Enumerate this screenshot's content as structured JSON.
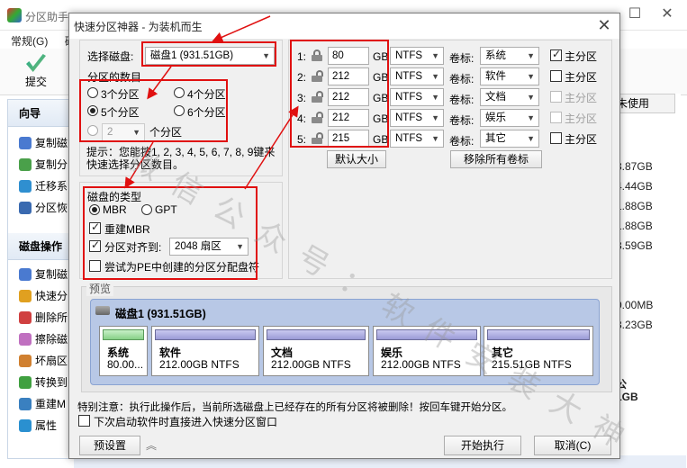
{
  "app": {
    "title": "分区助手",
    "menu": [
      "常规(G)",
      "磁"
    ],
    "toolbar": {
      "commit_label": "提交"
    },
    "sidebar": {
      "wizard_header": "向导",
      "wizard_items": [
        "复制磁",
        "复制分",
        "迁移系",
        "分区恢"
      ],
      "disk_ops_header": "磁盘操作",
      "disk_ops_items": [
        "复制磁",
        "快速分",
        "删除所",
        "擦除磁",
        "坏扇区",
        "转换到",
        "重建M",
        "属性"
      ]
    },
    "right_panel": {
      "header": "未使用",
      "values": [
        "3.87GB",
        "4.44GB",
        "1.88GB",
        "1.88GB",
        "3.59GB",
        "0.00MB",
        "3.23GB",
        "公",
        "1GB"
      ]
    }
  },
  "dialog": {
    "title": "快速分区神器 - 为装机而生",
    "select_disk_label": "选择磁盘:",
    "selected_disk": "磁盘1 (931.51GB)",
    "partition_count_label": "分区的数目",
    "count_options": [
      "3个分区",
      "4个分区",
      "5个分区",
      "6个分区"
    ],
    "count_selected": "5个分区",
    "custom_count_value": "2",
    "custom_count_suffix": "个分区",
    "hint": "提示：您能按1, 2, 3, 4, 5, 6, 7, 8, 9键来快速选择分区数目。",
    "disk_type_label": "磁盘的类型",
    "disk_type_options": [
      "MBR",
      "GPT"
    ],
    "disk_type_selected": "MBR",
    "rebuild_mbr_label": "重建MBR",
    "align_label": "分区对齐到:",
    "align_value": "2048 扇区",
    "pe_letter_label": "尝试为PE中创建的分区分配盘符",
    "partitions": [
      {
        "index": "1:",
        "size": "80",
        "unit": "GB",
        "fs": "NTFS",
        "vol_label": "卷标:",
        "name": "系统",
        "primary": true,
        "primary_enabled": true
      },
      {
        "index": "2:",
        "size": "212",
        "unit": "GB",
        "fs": "NTFS",
        "vol_label": "卷标:",
        "name": "软件",
        "primary": false,
        "primary_enabled": true
      },
      {
        "index": "3:",
        "size": "212",
        "unit": "GB",
        "fs": "NTFS",
        "vol_label": "卷标:",
        "name": "文档",
        "primary": false,
        "primary_enabled": false
      },
      {
        "index": "4:",
        "size": "212",
        "unit": "GB",
        "fs": "NTFS",
        "vol_label": "卷标:",
        "name": "娱乐",
        "primary": false,
        "primary_enabled": false
      },
      {
        "index": "5:",
        "size": "215",
        "unit": "GB",
        "fs": "NTFS",
        "vol_label": "卷标:",
        "name": "其它",
        "primary": false,
        "primary_enabled": true
      }
    ],
    "primary_label": "主分区",
    "default_size_button": "默认大小",
    "remove_labels_button": "移除所有卷标",
    "preview_label": "预览",
    "preview_disk": "磁盘1 (931.51GB)",
    "preview_parts": [
      {
        "name": "系统",
        "size": "80.00..."
      },
      {
        "name": "软件",
        "size": "212.00GB NTFS"
      },
      {
        "name": "文档",
        "size": "212.00GB NTFS"
      },
      {
        "name": "娱乐",
        "size": "212.00GB NTFS"
      },
      {
        "name": "其它",
        "size": "215.51GB NTFS"
      }
    ],
    "warning": "特别注意：执行此操作后，当前所选磁盘上已经存在的所有分区将被删除！按回车键开始分区。",
    "skip_label": "下次启动软件时直接进入快速分区窗口",
    "preset_button": "预设置",
    "start_button": "开始执行",
    "cancel_button": "取消(C)"
  },
  "watermark": "微信公众号：软件安装大神"
}
